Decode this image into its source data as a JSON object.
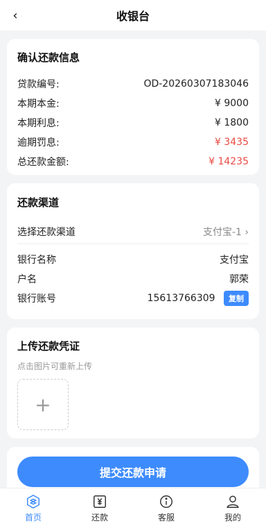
{
  "header": {
    "back_icon": "chevron-left-icon",
    "title": "收银台"
  },
  "confirm": {
    "title": "确认还款信息",
    "rows": [
      {
        "label": "贷款编号:",
        "value": "OD-20260307183046",
        "highlight": false
      },
      {
        "label": "本期本金:",
        "value": "¥ 9000",
        "highlight": false
      },
      {
        "label": "本期利息:",
        "value": "¥ 1800",
        "highlight": false
      },
      {
        "label": "逾期罚息:",
        "value": "¥ 3435",
        "highlight": true
      },
      {
        "label": "总还款金额:",
        "value": "¥ 14235",
        "highlight": true
      }
    ]
  },
  "channel": {
    "title": "还款渠道",
    "select_label": "选择还款渠道",
    "select_value": "支付宝-1 ›",
    "bank_name_label": "银行名称",
    "bank_name_value": "支付宝",
    "holder_label": "户名",
    "holder_value": "郭荣",
    "account_label": "银行账号",
    "account_value": "15613766309",
    "copy_label": "复制"
  },
  "upload": {
    "title": "上传还款凭证",
    "hint": "点击图片可重新上传",
    "add_icon": "+"
  },
  "submit_label": "提交还款申请",
  "tabbar": [
    {
      "label": "首页",
      "icon": "home-icon",
      "active": true
    },
    {
      "label": "还款",
      "icon": "repay-icon",
      "active": false
    },
    {
      "label": "客服",
      "icon": "service-icon",
      "active": false
    },
    {
      "label": "我的",
      "icon": "user-icon",
      "active": false
    }
  ],
  "colors": {
    "accent": "#3d8bfd",
    "red": "#e84a43"
  }
}
